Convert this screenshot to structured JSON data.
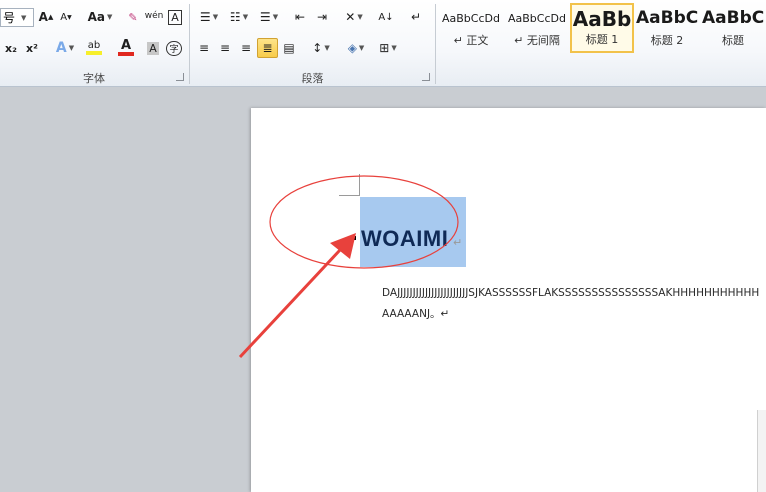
{
  "ribbon": {
    "font_group": {
      "label": "字体",
      "font_size_fragment": "号",
      "grow_font": "A",
      "shrink_font": "A",
      "change_case": "Aa",
      "phonetic_guide": "wén",
      "char_border": "A",
      "subscript": "x₂",
      "superscript": "x²",
      "text_effects": "A",
      "highlight": "ab",
      "font_color": "A",
      "char_shading": "A",
      "enclose_char": "字"
    },
    "paragraph_group": {
      "label": "段落",
      "sort": "A↓",
      "show_marks": "↵"
    },
    "styles": [
      {
        "sample": "AaBbCcDd",
        "name": "↵ 正文"
      },
      {
        "sample": "AaBbCcDd",
        "name": "↵ 无间隔"
      },
      {
        "sample": "AaBb",
        "name": "标题 1"
      },
      {
        "sample": "AaBbC",
        "name": "标题 2"
      },
      {
        "sample": "AaBbC",
        "name": "标题"
      }
    ]
  },
  "document": {
    "heading": "WOAIMI",
    "heading_mark": "↵",
    "body_line_1": "DAJJJJJJJJJJJJJJJJJJJJJJJSJKASSSSSSFLAKSSSSSSSSSSSSSSSAKHHHHHHHHHHH",
    "body_line_2": "AAAAANJ。↵"
  },
  "colors": {
    "annotation": "#e8413c",
    "selection": "#a7c9ef",
    "active_button": "#f8cc4a"
  }
}
